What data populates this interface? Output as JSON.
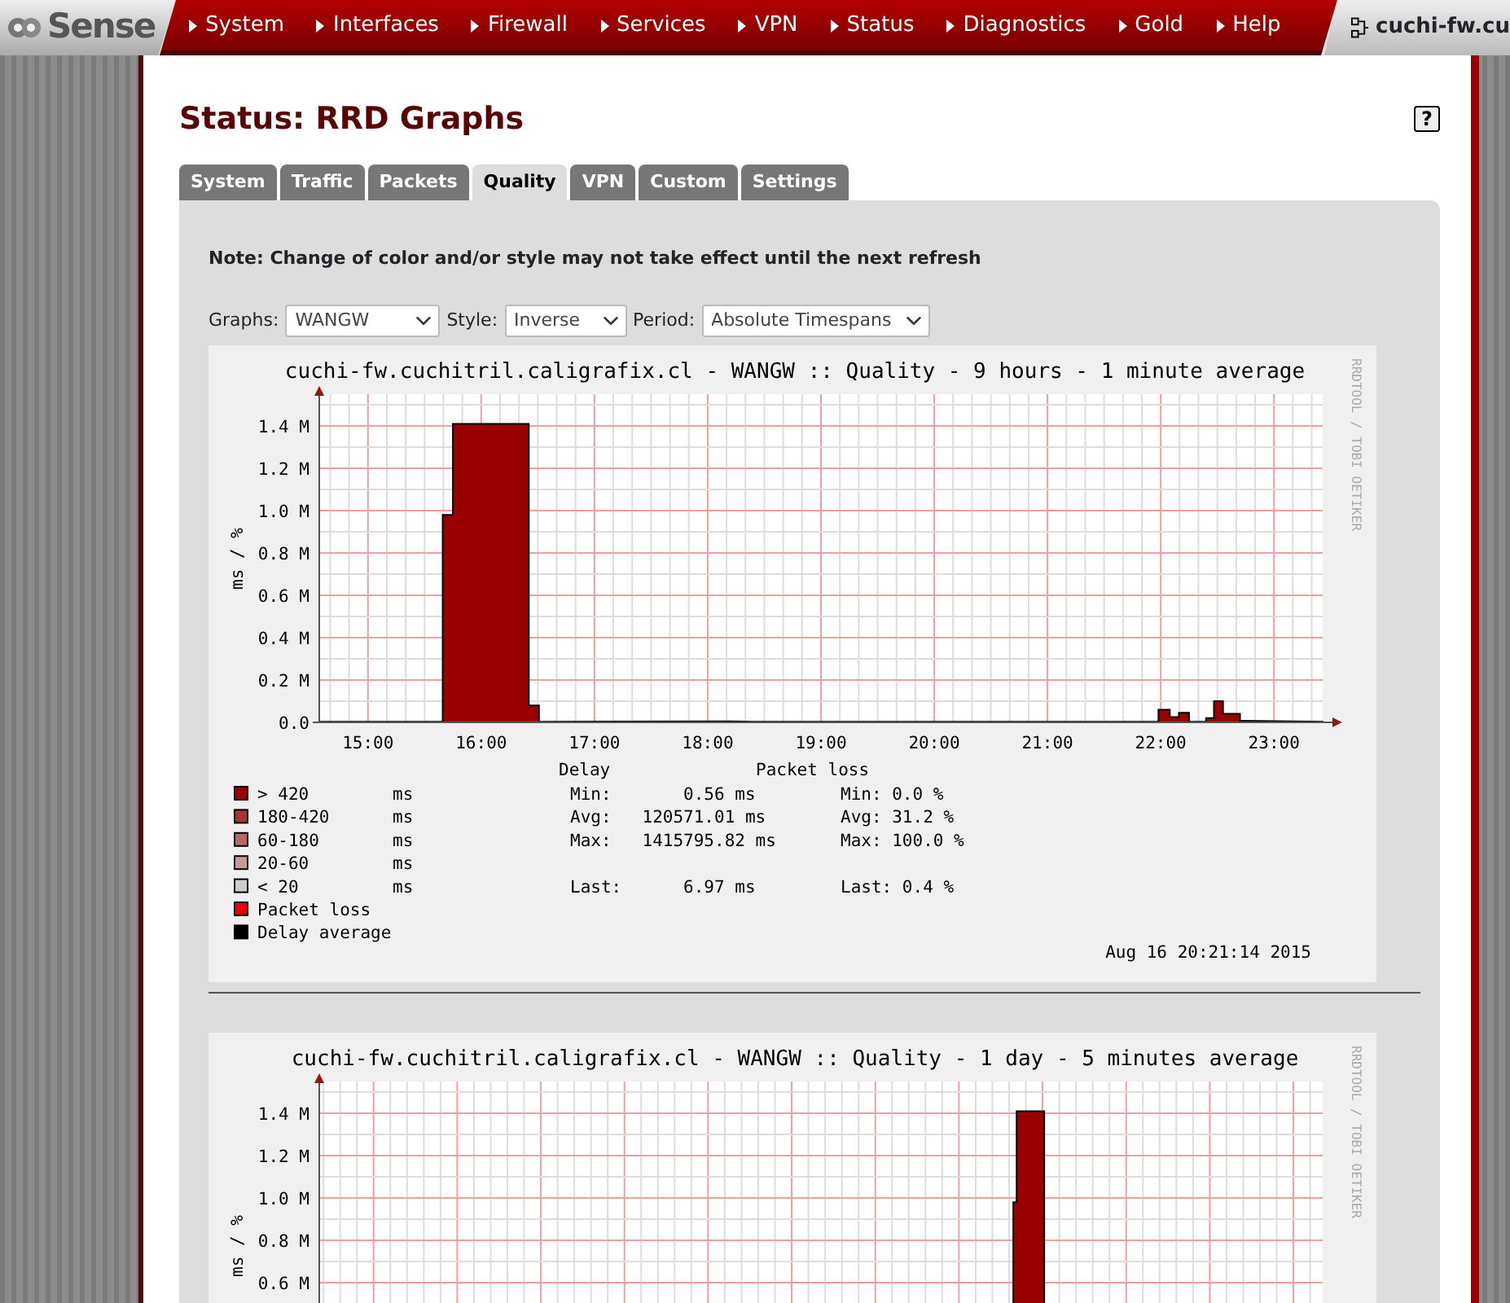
{
  "logo": {
    "text": "Sense"
  },
  "menu": [
    {
      "label": "System"
    },
    {
      "label": "Interfaces"
    },
    {
      "label": "Firewall"
    },
    {
      "label": "Services"
    },
    {
      "label": "VPN"
    },
    {
      "label": "Status"
    },
    {
      "label": "Diagnostics"
    },
    {
      "label": "Gold"
    },
    {
      "label": "Help"
    }
  ],
  "hostname": "cuchi-fw.cu",
  "page_title": "Status: RRD Graphs",
  "help_label": "?",
  "tabs": [
    {
      "label": "System",
      "selected": false
    },
    {
      "label": "Traffic",
      "selected": false
    },
    {
      "label": "Packets",
      "selected": false
    },
    {
      "label": "Quality",
      "selected": true
    },
    {
      "label": "VPN",
      "selected": false
    },
    {
      "label": "Custom",
      "selected": false
    },
    {
      "label": "Settings",
      "selected": false
    }
  ],
  "note": "Note: Change of color and/or style may not take effect until the next refresh",
  "filters": [
    {
      "label": "Graphs:",
      "value": "WANGW"
    },
    {
      "label": "Style:",
      "value": "Inverse"
    },
    {
      "label": "Period:",
      "value": "Absolute Timespans"
    }
  ],
  "graphs": [
    {
      "title": "cuchi-fw.cuchitril.caligrafix.cl - WANGW :: Quality - 9 hours - 1 minute average",
      "credit": "RRDTOOL / TOBI OETIKER",
      "chart_data": {
        "type": "area",
        "ylabel": "ms / %",
        "grid": true,
        "xlim": [
          14.57,
          23.43
        ],
        "ylim": [
          0,
          1.55
        ],
        "xticks": [
          {
            "value": 15,
            "label": "15:00"
          },
          {
            "value": 16,
            "label": "16:00"
          },
          {
            "value": 17,
            "label": "17:00"
          },
          {
            "value": 18,
            "label": "18:00"
          },
          {
            "value": 19,
            "label": "19:00"
          },
          {
            "value": 20,
            "label": "20:00"
          },
          {
            "value": 21,
            "label": "21:00"
          },
          {
            "value": 22,
            "label": "22:00"
          },
          {
            "value": 23,
            "label": "23:00"
          }
        ],
        "yticks": [
          {
            "value": 0,
            "label": "0.0"
          },
          {
            "value": 0.2,
            "label": "0.2 M"
          },
          {
            "value": 0.4,
            "label": "0.4 M"
          },
          {
            "value": 0.6,
            "label": "0.6 M"
          },
          {
            "value": 0.8,
            "label": "0.8 M"
          },
          {
            "value": 1.0,
            "label": "1.0 M"
          },
          {
            "value": 1.2,
            "label": "1.2 M"
          },
          {
            "value": 1.4,
            "label": "1.4 M"
          }
        ],
        "x": [
          14.57,
          15.66,
          15.66,
          15.75,
          15.75,
          16.42,
          16.42,
          16.51,
          16.51,
          18.2,
          18.4,
          21.9,
          21.98,
          21.98,
          22.08,
          22.08,
          22.16,
          22.16,
          22.25,
          22.25,
          22.4,
          22.4,
          22.47,
          22.47,
          22.55,
          22.55,
          22.7,
          22.7,
          23.43
        ],
        "series": [
          {
            "color": "#990000",
            "values": [
              0.003,
              0.003,
              0.98,
              0.98,
              1.41,
              1.41,
              0.08,
              0.08,
              0.003,
              0.005,
              0.003,
              0.003,
              0.003,
              0.06,
              0.06,
              0.025,
              0.025,
              0.045,
              0.045,
              0.003,
              0.003,
              0.02,
              0.02,
              0.1,
              0.1,
              0.04,
              0.04,
              0.008,
              0.003
            ]
          }
        ]
      },
      "legend": [
        {
          "label": "> 420",
          "unit": "ms",
          "color": "#990000"
        },
        {
          "label": "180-420",
          "unit": "ms",
          "color": "#a83333"
        },
        {
          "label": "60-180",
          "unit": "ms",
          "color": "#b86666"
        },
        {
          "label": "20-60",
          "unit": "ms",
          "color": "#c89999"
        },
        {
          "label": "< 20",
          "unit": "ms",
          "color": "#cccccc"
        },
        {
          "label": "Packet loss",
          "color": "#ee0000"
        },
        {
          "label": "Delay average",
          "color": "#000000"
        }
      ],
      "stats_headers": [
        "Delay",
        "Packet loss"
      ],
      "delay_stats": [
        "Min:       0.56 ms",
        "Avg:   120571.01 ms",
        "Max:   1415795.82 ms",
        "Last:      6.97 ms"
      ],
      "loss_stats": [
        "Min: 0.0 %",
        "Avg: 31.2 %",
        "Max: 100.0 %",
        "Last: 0.4 %"
      ],
      "timestamp": "Aug 16 20:21:14 2015"
    },
    {
      "title": "cuchi-fw.cuchitril.caligrafix.cl - WANGW :: Quality - 1 day - 5 minutes average",
      "credit": "RRDTOOL / TOBI OETIKER",
      "ylabel": "ms / %",
      "y_tick_labels": [
        "1.4 M",
        "1.2 M",
        "1.0 M",
        "0.8 M",
        "0.6 M"
      ]
    }
  ]
}
